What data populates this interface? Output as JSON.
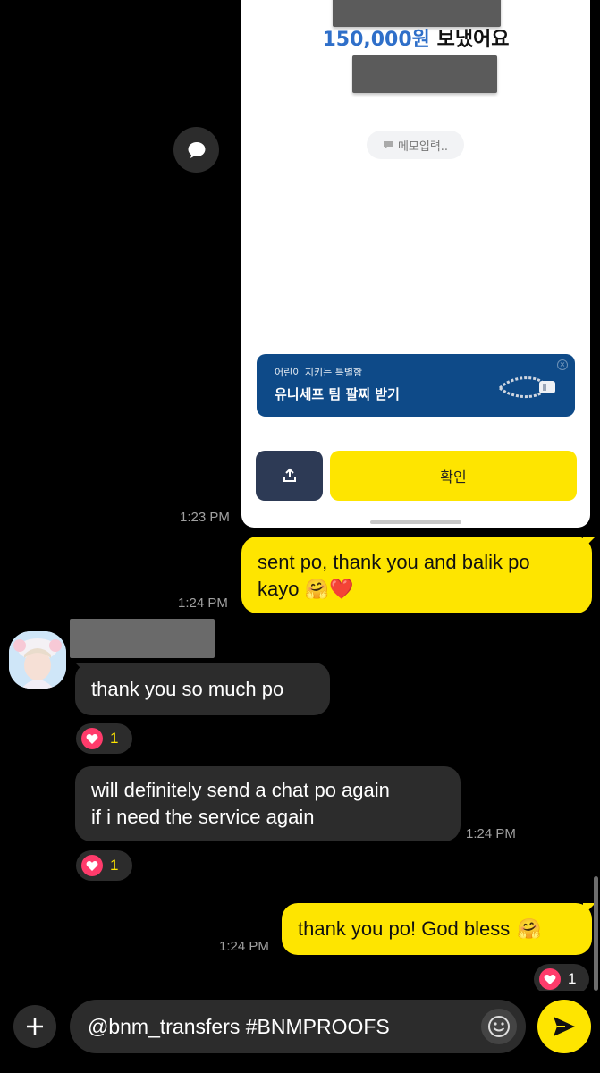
{
  "shared_image": {
    "amount": "150,000원",
    "amount_suffix": "보냈어요",
    "memo_placeholder": "메모입력..",
    "promo_subtitle": "어린이 지키는 특별함",
    "promo_title": "유니세프 팀 팔찌 받기",
    "confirm_label": "확인"
  },
  "messages": [
    {
      "id": "m1",
      "time": "1:23 PM"
    },
    {
      "id": "m2",
      "direction": "out",
      "text": "sent po, thank you and balik po kayo",
      "emojis": "🤗❤️",
      "time": "1:24 PM"
    },
    {
      "id": "m3",
      "direction": "in",
      "text": "thank you so much po",
      "reaction_count": "1"
    },
    {
      "id": "m4",
      "direction": "in",
      "text_line1": "will definitely send a chat po again",
      "text_line2": "if i need the service again",
      "time": "1:24 PM",
      "reaction_count": "1"
    },
    {
      "id": "m5",
      "direction": "out",
      "text": "thank you po! God bless",
      "emojis": "🤗",
      "time": "1:24 PM",
      "reaction_count": "1"
    }
  ],
  "input": {
    "value": "@bnm_transfers #BNMPROOFS"
  },
  "colors": {
    "outgoing_bubble": "#fee500",
    "incoming_bubble": "#2c2c2c",
    "background": "#000000",
    "reaction_heart": "#ff3b6b",
    "promo_banner": "#0e4a88"
  },
  "icons": [
    "chat-bubble-icon",
    "share-icon",
    "heart-icon",
    "plus-icon",
    "emoji-icon",
    "send-icon",
    "memo-icon",
    "bracelet-icon"
  ]
}
